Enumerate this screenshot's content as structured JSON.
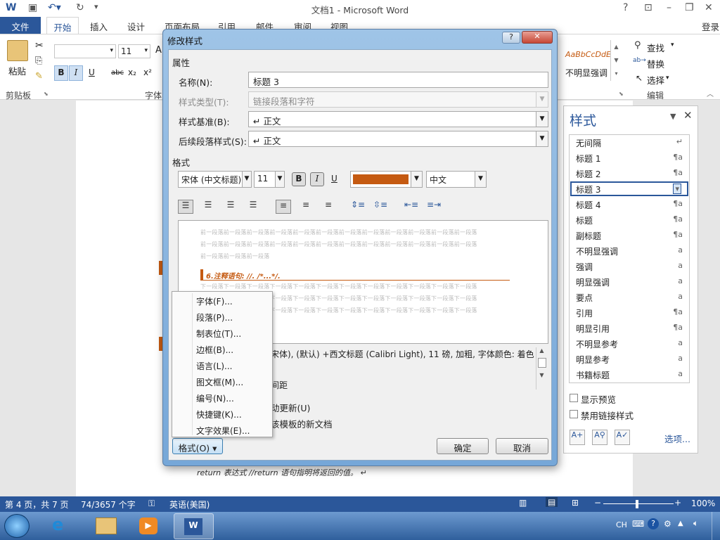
{
  "window": {
    "title": "文档1 - Microsoft Word",
    "help": "?",
    "login": "登录"
  },
  "ribbon": {
    "tabs": [
      "文件",
      "开始",
      "插入",
      "设计",
      "页面布局",
      "引用",
      "邮件",
      "审阅",
      "视图"
    ],
    "clipboard_label": "剪贴板",
    "paste_label": "粘贴",
    "font_size": "11",
    "font_group_label": "字体",
    "style_gallery_sample": "AaBbCcDdE",
    "style_gallery_name": "不明显强调",
    "find_label": "查找",
    "replace_label": "替换",
    "select_label": "选择",
    "edit_group_label": "编辑",
    "bold": "B",
    "italic": "I",
    "underline": "U",
    "strike": "abc",
    "sub": "x₂",
    "sup": "x²"
  },
  "dialog": {
    "title": "修改样式",
    "properties_heading": "属性",
    "name_label": "名称(N):",
    "name_value": "标题 3",
    "type_label": "样式类型(T):",
    "type_value": "链接段落和字符",
    "based_label": "样式基准(B):",
    "based_value": "↵ 正文",
    "next_label": "后续段落样式(S):",
    "next_value": "↵ 正文",
    "format_heading": "格式",
    "font_name": "宋体 (中文标题)",
    "font_size": "11",
    "bold": "B",
    "italic": "I",
    "underline": "U",
    "font_color": "#c55a11",
    "script": "中文",
    "preview_before": "前一段落前一段落前一段落前一段落前一段落前一段落前一段落前一段落前一段落前一段落前一段落前一段落",
    "preview_before_short": "前一段落前一段落前一段落",
    "preview_heading": "6.注释语句: //. /*...*/.",
    "preview_after": "下一段落下一段落下一段落下一段落下一段落下一段落下一段落下一段落下一段落下一段落下一段落下一段落",
    "description_line1": "宋体), (默认) +西文标题 (Calibri Light), 11 磅, 加粗, 字体颜色: 着色",
    "description_line2": "间距",
    "auto_update_label": "动更新(U)",
    "template_label": "该模板的新文档",
    "format_button": "格式(O) ▾",
    "ok_button": "确定",
    "cancel_button": "取消"
  },
  "format_menu": [
    "字体(F)...",
    "段落(P)...",
    "制表位(T)...",
    "边框(B)...",
    "语言(L)...",
    "图文框(M)...",
    "编号(N)...",
    "快捷键(K)...",
    "文字效果(E)..."
  ],
  "styles_pane": {
    "title": "样式",
    "items": [
      {
        "name": "无间隔",
        "mark": "↵"
      },
      {
        "name": "标题 1",
        "mark": "¶a"
      },
      {
        "name": "标题 2",
        "mark": "¶a"
      },
      {
        "name": "标题 3",
        "mark": "▾"
      },
      {
        "name": "标题 4",
        "mark": "¶a"
      },
      {
        "name": "标题",
        "mark": "¶a"
      },
      {
        "name": "副标题",
        "mark": "¶a"
      },
      {
        "name": "不明显强调",
        "mark": "a"
      },
      {
        "name": "强调",
        "mark": "a"
      },
      {
        "name": "明显强调",
        "mark": "a"
      },
      {
        "name": "要点",
        "mark": "a"
      },
      {
        "name": "引用",
        "mark": "¶a"
      },
      {
        "name": "明显引用",
        "mark": "¶a"
      },
      {
        "name": "不明显参考",
        "mark": "a"
      },
      {
        "name": "明显参考",
        "mark": "a"
      },
      {
        "name": "书籍标题",
        "mark": "a"
      }
    ],
    "show_preview_label": "显示预览",
    "disable_linked_label": "禁用链接样式",
    "options_label": "选项..."
  },
  "document": {
    "code_line": "return 表达式 //return 语句指明将返回的值。 ↵"
  },
  "status": {
    "page": "第 4 页，共 7 页",
    "words": "74/3657 个字",
    "language": "英语(美国)",
    "zoom": "100%"
  },
  "taskbar": {
    "ime": "CH"
  }
}
